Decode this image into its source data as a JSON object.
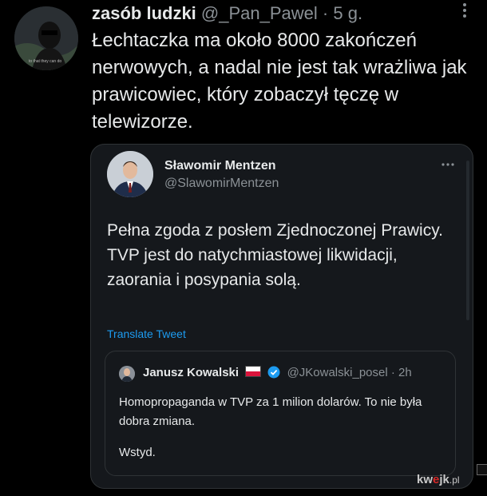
{
  "tweet": {
    "author_name": "zasób ludzki",
    "handle": "@_Pan_Pawel",
    "dot": "·",
    "time": "5 g.",
    "text": "Łechtaczka ma około 8000 zakończeń nerwowych, a nadal nie jest tak wrażliwa jak prawicowiec, który zobaczył tęczę w telewizorze.",
    "avatar_caption": "to that they can do",
    "more_icon": "more-vertical-icon"
  },
  "quoted": {
    "author_name": "Sławomir Mentzen",
    "handle": "@SlawomirMentzen",
    "text": "Pełna zgoda z posłem Zjednoczonej Prawicy. TVP jest do natychmiastowej likwidacji, zaorania i posypania solą.",
    "translate_label": "Translate Tweet",
    "more_icon": "more-horizontal-icon"
  },
  "nested": {
    "author_name": "Janusz Kowalski",
    "flag_icon": "poland-flag-icon",
    "verified_icon": "verified-badge-icon",
    "handle": "@JKowalski_posel",
    "dot": "·",
    "time": "2h",
    "text": "Homopropaganda w TVP za 1 milion dolarów. To nie była dobra zmiana.",
    "text2": "Wstyd."
  },
  "watermark": {
    "part1": "kw",
    "part2": "e",
    "part3": "jk",
    "part4": ".pl"
  },
  "colors": {
    "background": "#000000",
    "card_background": "#15181c",
    "text": "#e7e9ea",
    "muted": "#8b9196",
    "link": "#1d9bf0",
    "verified": "#1d9bf0"
  }
}
